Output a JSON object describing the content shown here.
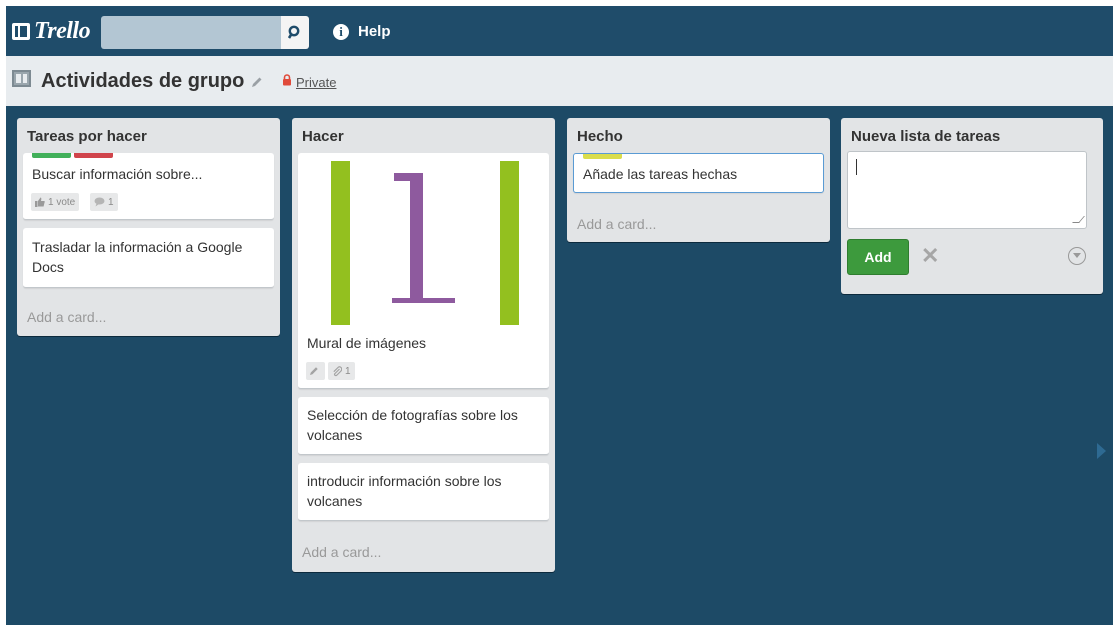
{
  "app": {
    "name": "Trello"
  },
  "header": {
    "help_label": "Help",
    "search_placeholder": ""
  },
  "board": {
    "title": "Actividades de grupo",
    "visibility": "Private"
  },
  "colors": {
    "header_bg": "#1f4c6a",
    "board_bg": "#1d4a66",
    "label_green": "#42b05a",
    "label_red": "#d0444b",
    "label_yellow": "#dadd4c",
    "add_button": "#3d9a3d"
  },
  "lists": [
    {
      "title": "Tareas por hacer",
      "cards": [
        {
          "text": "Buscar información sobre...",
          "labels": [
            "green",
            "red"
          ],
          "votes": "1 vote",
          "comments": "1"
        },
        {
          "text": "Trasladar la información a Google Docs"
        }
      ],
      "add_card": "Add a card..."
    },
    {
      "title": "Hacer",
      "cards": [
        {
          "text": "Mural de imágenes",
          "cover": "number-1-image",
          "attachments": "1"
        },
        {
          "text": "Selección de fotografías sobre los volcanes"
        },
        {
          "text": "introducir información sobre los volcanes"
        }
      ],
      "add_card": "Add a card..."
    },
    {
      "title": "Hecho",
      "cards": [
        {
          "text": "Añade las tareas hechas",
          "labels": [
            "yellow"
          ]
        }
      ],
      "add_card": "Add a card..."
    }
  ],
  "new_list": {
    "title": "Nueva lista de tareas",
    "input_value": "",
    "add_label": "Add"
  }
}
